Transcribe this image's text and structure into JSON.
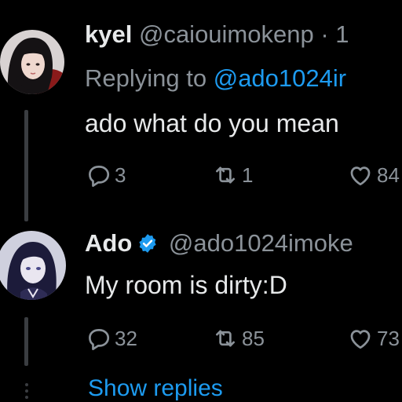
{
  "tweets": [
    {
      "name": "kyel",
      "handle": "@caiouimokenp",
      "separator": "· 1",
      "replying_prefix": "Replying to ",
      "replying_to": "@ado1024ir",
      "text": "ado what do you mean",
      "replies": "3",
      "retweets": "1",
      "likes": "84"
    },
    {
      "name": "Ado",
      "verified": true,
      "handle": "@ado1024imoke",
      "text": "My room is dirty:D",
      "replies": "32",
      "retweets": "85",
      "likes": "73"
    }
  ],
  "show_replies": "Show replies",
  "colors": {
    "background": "#000000",
    "text": "#e7e9ea",
    "muted": "#8b9299",
    "accent": "#1d9bf0"
  },
  "icons": [
    "reply-icon",
    "retweet-icon",
    "like-icon",
    "verified-badge-icon"
  ]
}
